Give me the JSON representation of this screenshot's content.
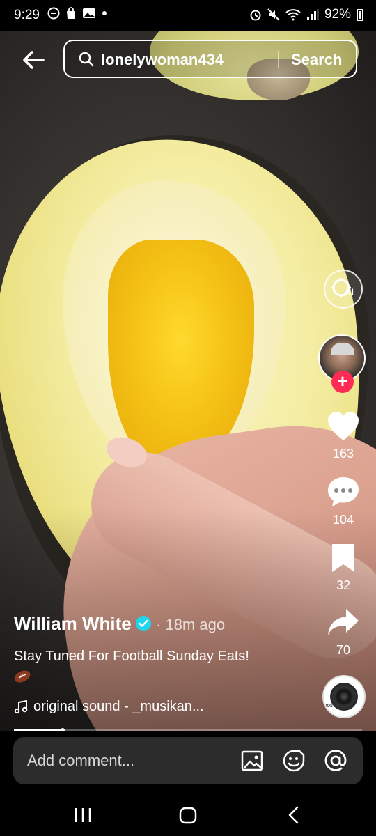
{
  "status_bar": {
    "time": "9:29",
    "left_icons": [
      "minus-circle-icon",
      "shopping-bag-icon",
      "gallery-icon",
      "dot-icon"
    ],
    "right_icons": [
      "alarm-icon",
      "mute-icon",
      "wifi-icon",
      "signal-icon"
    ],
    "battery": "92%"
  },
  "search": {
    "value": "lonelywoman434",
    "button_label": "Search"
  },
  "actions": {
    "likes": "163",
    "comments": "104",
    "saves": "32",
    "shares": "70"
  },
  "video_info": {
    "author": "William White",
    "time_ago": "· 18m ago",
    "caption": "Stay Tuned For Football Sunday Eats!",
    "sound": "original sound - _musikan...",
    "disc_label": "NOSTALGIA"
  },
  "progress": {
    "fraction": 0.14
  },
  "comment": {
    "placeholder": "Add comment..."
  },
  "colors": {
    "accent_red": "#fe2c55",
    "verified_blue": "#20d5ec"
  }
}
